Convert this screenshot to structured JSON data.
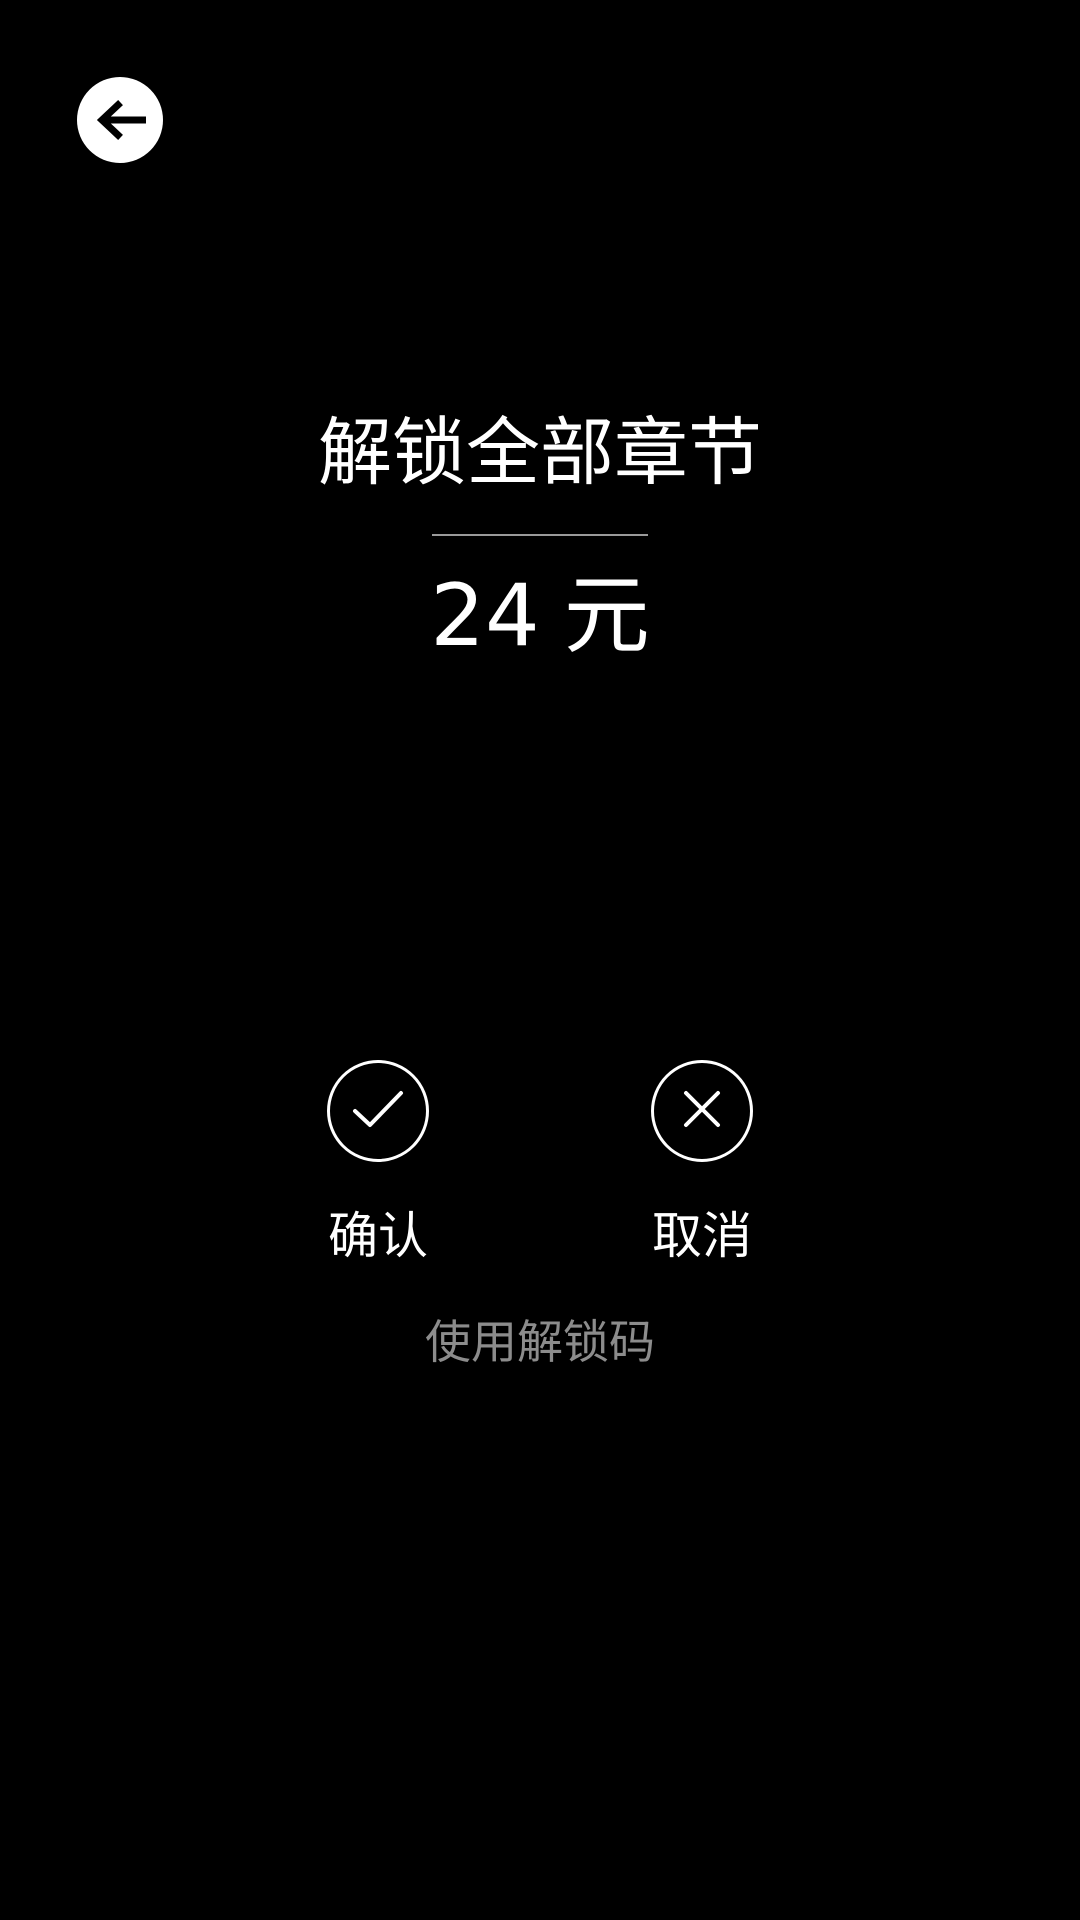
{
  "header": {
    "back_icon": "arrow-left-icon"
  },
  "dialog": {
    "title": "解锁全部章节",
    "price": {
      "amount": "24",
      "unit": "元"
    }
  },
  "actions": {
    "confirm": {
      "icon": "check-icon",
      "label": "确认"
    },
    "cancel": {
      "icon": "close-icon",
      "label": "取消"
    }
  },
  "links": {
    "use_unlock_code": "使用解锁码"
  },
  "colors": {
    "background": "#000000",
    "foreground": "#ffffff",
    "muted": "#8c8c8c"
  }
}
